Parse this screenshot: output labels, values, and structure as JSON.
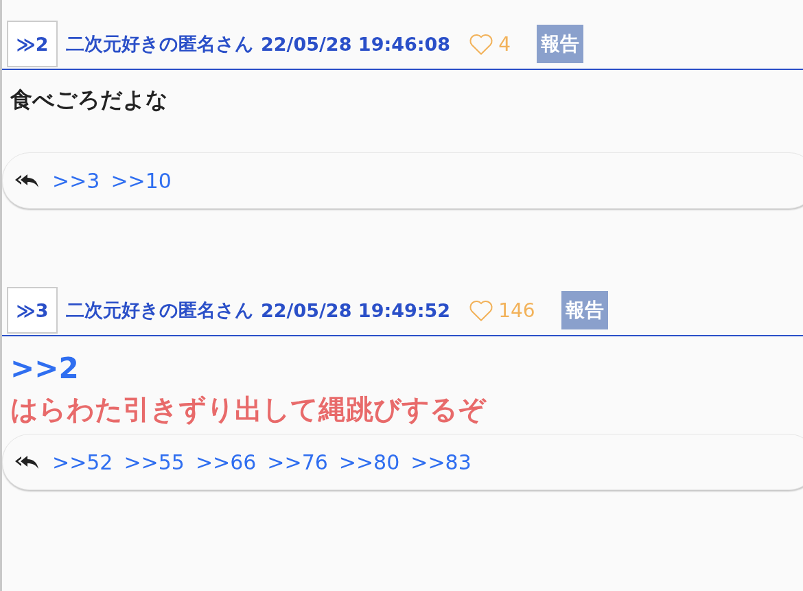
{
  "posts": [
    {
      "number": "≫2",
      "author": "二次元好きの匿名さん",
      "datetime": "22/05/28 19:46:08",
      "likes": "4",
      "report": "報告",
      "body": [
        {
          "kind": "text",
          "text": "食べごろだよな",
          "color": "#222222"
        }
      ],
      "replies": [
        ">>3",
        ">>10"
      ]
    },
    {
      "number": "≫3",
      "author": "二次元好きの匿名さん",
      "datetime": "22/05/28 19:49:52",
      "likes": "146",
      "report": "報告",
      "body": [
        {
          "kind": "anchor",
          "text": ">>2"
        },
        {
          "kind": "text",
          "text": "はらわた引きずり出して縄跳びするぞ",
          "color": "#e86a6a"
        }
      ],
      "replies": [
        ">>52",
        ">>55",
        ">>66",
        ">>76",
        ">>80",
        ">>83"
      ]
    }
  ]
}
